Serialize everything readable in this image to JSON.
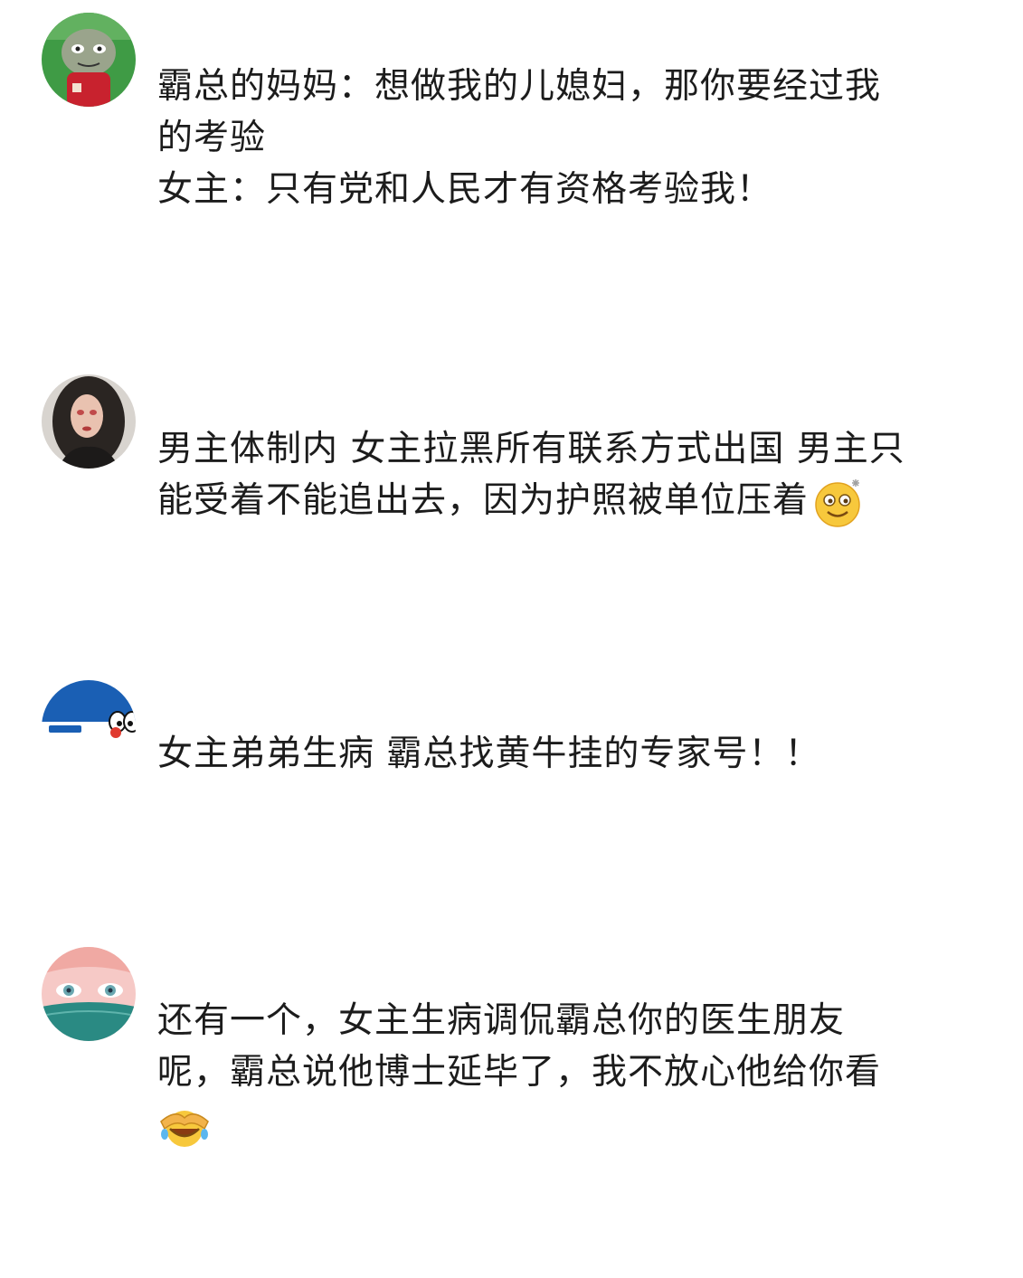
{
  "comments": [
    {
      "avatar_icon": "cartoon-avatar-icon",
      "lines": [
        "霸总的妈妈：想做我的儿媳妇，那你要经过我",
        "的考验",
        "女主：只有党和人民才有资格考验我！"
      ]
    },
    {
      "avatar_icon": "woman-portrait-avatar-icon",
      "lines": [
        "男主体制内 女主拉黑所有联系方式出国 男主只",
        "能受着不能追出去，因为护照被单位压着"
      ],
      "emoji": "dizzy-smile-emoji-icon"
    },
    {
      "avatar_icon": "doraemon-avatar-icon",
      "lines": [
        "女主弟弟生病  霸总找黄牛挂的专家号！！"
      ]
    },
    {
      "avatar_icon": "anime-eyes-avatar-icon",
      "lines": [
        "还有一个，女主生病调侃霸总你的医生朋友",
        "呢，霸总说他博士延毕了，我不放心他给你看"
      ],
      "emoji": "facepalm-laugh-emoji-icon"
    }
  ]
}
